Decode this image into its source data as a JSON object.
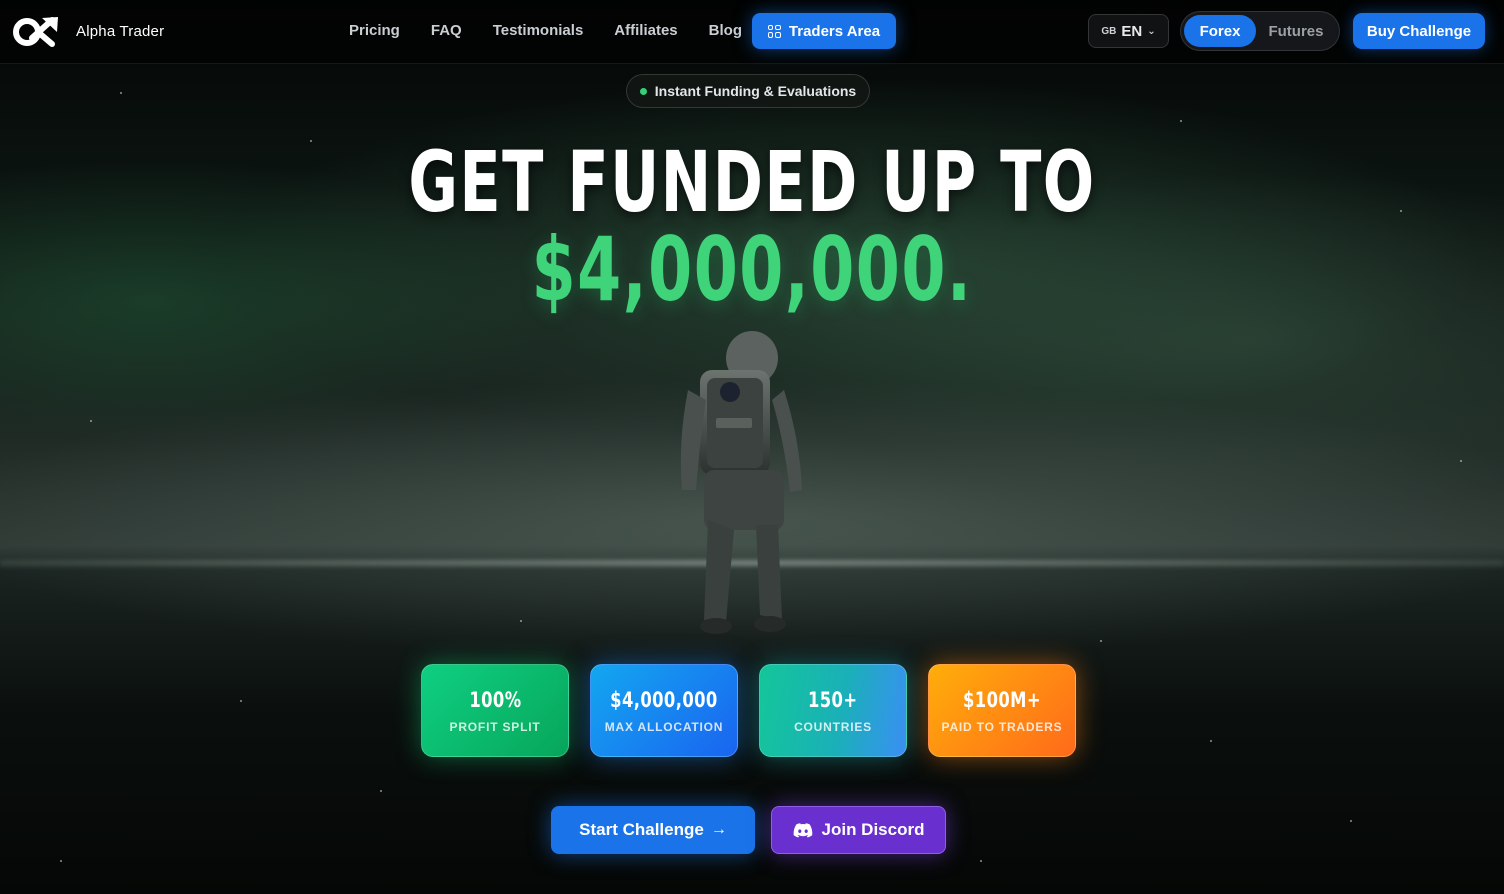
{
  "brand": {
    "name": "Alpha Trader",
    "logo_icon": "alpha-trader-logo"
  },
  "nav": {
    "items": [
      {
        "label": "Pricing"
      },
      {
        "label": "FAQ"
      },
      {
        "label": "Testimonials"
      },
      {
        "label": "Affiliates"
      },
      {
        "label": "Blog"
      }
    ],
    "traders_area_label": "Traders Area",
    "traders_area_icon": "grid-icon"
  },
  "language": {
    "flag": "GB",
    "code": "EN"
  },
  "market_toggle": {
    "options": [
      "Forex",
      "Futures"
    ],
    "selected": "Forex"
  },
  "buy_challenge_label": "Buy Challenge",
  "hero": {
    "badge": "Instant Funding & Evaluations",
    "headline_line1": "GET FUNDED UP TO",
    "headline_line2": "$4,000,000."
  },
  "stats": [
    {
      "value": "100%",
      "label": "PROFIT SPLIT",
      "color": "#0fcf82"
    },
    {
      "value": "$4,000,000",
      "label": "MAX ALLOCATION",
      "color": "#1a64f0"
    },
    {
      "value": "150+",
      "label": "COUNTRIES",
      "color": "#1ab0b8"
    },
    {
      "value": "$100M+",
      "label": "PAID TO TRADERS",
      "color": "#ff8a14"
    }
  ],
  "cta": {
    "start_label": "Start Challenge",
    "discord_label": "Join Discord"
  },
  "colors": {
    "accent_blue": "#1a73e8",
    "highlight_green": "#3fd47a",
    "discord_purple": "#6a2fcf"
  }
}
